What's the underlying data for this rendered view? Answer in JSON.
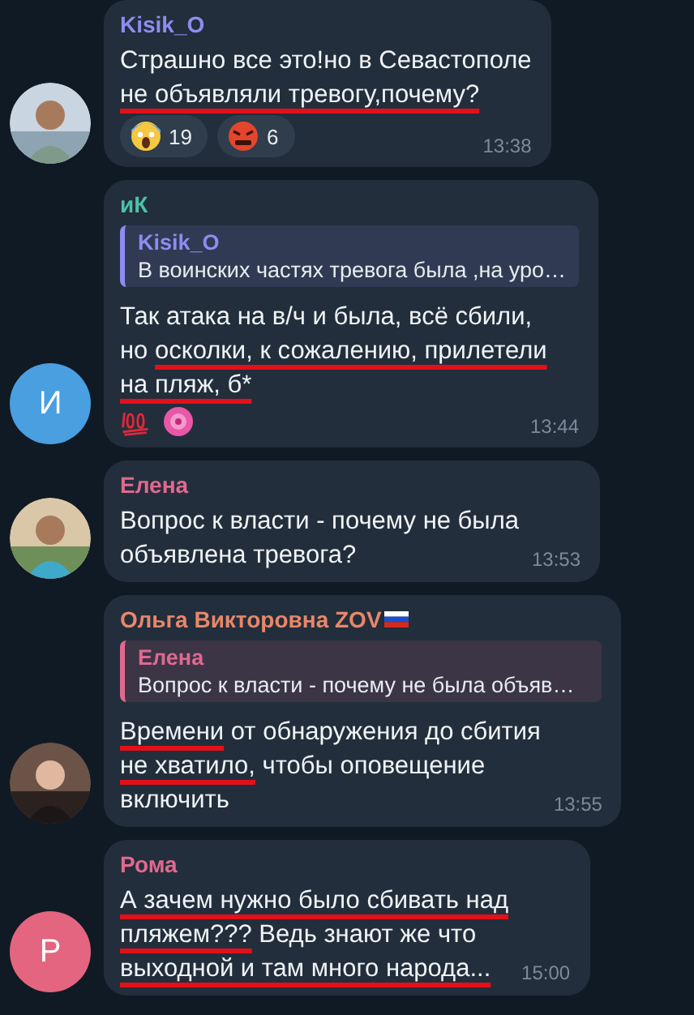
{
  "messages": [
    {
      "author": "Kisik_O",
      "color": "#8e8cf0",
      "avatar": {
        "kind": "picture"
      },
      "lines": [
        [
          {
            "text": "Страшно все это!но в Севастополе",
            "underlined": false
          }
        ],
        [
          {
            "text": "не объявляли тревогу,почему?",
            "underlined": true
          }
        ]
      ],
      "reactions": [
        {
          "kind": "scream",
          "count": "19"
        },
        {
          "kind": "angry",
          "count": "6"
        }
      ],
      "time": "13:38"
    },
    {
      "author": "иК",
      "color": "#4cc2a4",
      "avatar": {
        "kind": "letter",
        "letter": "И",
        "color": "#4a9fe0"
      },
      "reply": {
        "author": "Kisik_O",
        "color": "#8e8cf0",
        "text": "В воинских частях тревога была ,на уро…"
      },
      "lines": [
        [
          {
            "text": "Так атака на в/ч и была, всё сбили,",
            "underlined": false
          }
        ],
        [
          {
            "text": "но ",
            "underlined": false
          },
          {
            "text": "осколки, к сожалению, прилетели",
            "underlined": true
          }
        ],
        [
          {
            "text": "на пляж, б*",
            "underlined": true
          }
        ]
      ],
      "reactions": [
        {
          "kind": "hundred"
        },
        {
          "kind": "flower"
        }
      ],
      "time": "13:44"
    },
    {
      "author": "Елена",
      "color": "#e0698f",
      "avatar": {
        "kind": "picture"
      },
      "lines": [
        [
          {
            "text": "Вопрос к власти - почему не была",
            "underlined": false
          }
        ],
        [
          {
            "text": "объявлена тревога?",
            "underlined": false
          }
        ]
      ],
      "time": "13:53"
    },
    {
      "author": "Ольга Викторовна ZOV",
      "flag": true,
      "color": "#e8876a",
      "avatar": {
        "kind": "picture"
      },
      "reply": {
        "author": "Елена",
        "color": "#e0698f",
        "text": "Вопрос к власти - почему не была объяв…"
      },
      "lines": [
        [
          {
            "text": "Времени",
            "underlined": true
          },
          {
            "text": " от обнаружения до сбития",
            "underlined": false
          }
        ],
        [
          {
            "text": "не хватило,",
            "underlined": true
          },
          {
            "text": " чтобы оповещение",
            "underlined": false
          }
        ],
        [
          {
            "text": "включить",
            "underlined": false
          }
        ]
      ],
      "time": "13:55"
    },
    {
      "author": "Рома",
      "color": "#e0698f",
      "avatar": {
        "kind": "letter",
        "letter": "Р",
        "color": "#e4657f"
      },
      "lines": [
        [
          {
            "text": "А зачем нужно было сбивать над",
            "underlined": true
          }
        ],
        [
          {
            "text": "пляжем???",
            "underlined": true
          },
          {
            "text": " Ведь знают же что",
            "underlined": false
          }
        ],
        [
          {
            "text": "выходной и там много народа...",
            "underlined": true
          }
        ]
      ],
      "time": "15:00"
    }
  ]
}
